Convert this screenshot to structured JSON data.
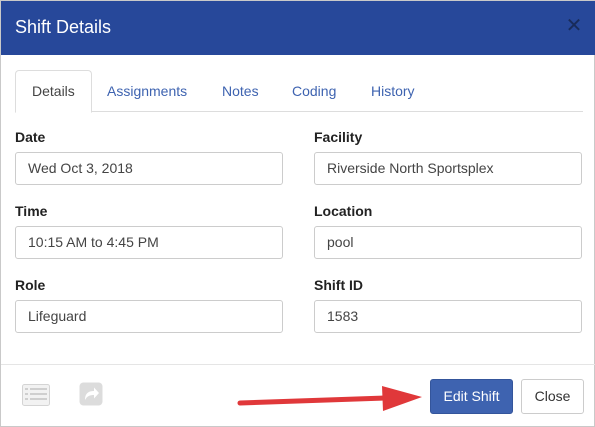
{
  "header": {
    "title": "Shift Details",
    "close_glyph": "✕"
  },
  "tabs": [
    {
      "label": "Details",
      "active": true
    },
    {
      "label": "Assignments",
      "active": false
    },
    {
      "label": "Notes",
      "active": false
    },
    {
      "label": "Coding",
      "active": false
    },
    {
      "label": "History",
      "active": false
    }
  ],
  "fields": {
    "date": {
      "label": "Date",
      "value": "Wed Oct 3, 2018"
    },
    "facility": {
      "label": "Facility",
      "value": "Riverside North Sportsplex"
    },
    "time": {
      "label": "Time",
      "value": "10:15 AM to 4:45 PM"
    },
    "location": {
      "label": "Location",
      "value": "pool"
    },
    "role": {
      "label": "Role",
      "value": "Lifeguard"
    },
    "shift_id": {
      "label": "Shift ID",
      "value": "1583"
    }
  },
  "footer": {
    "icons": [
      "list-icon",
      "share-icon"
    ],
    "edit_label": "Edit Shift",
    "close_label": "Close"
  },
  "colors": {
    "header_bg": "#27489a",
    "accent": "#3e63b0",
    "annotation_arrow": "#e0383a"
  }
}
